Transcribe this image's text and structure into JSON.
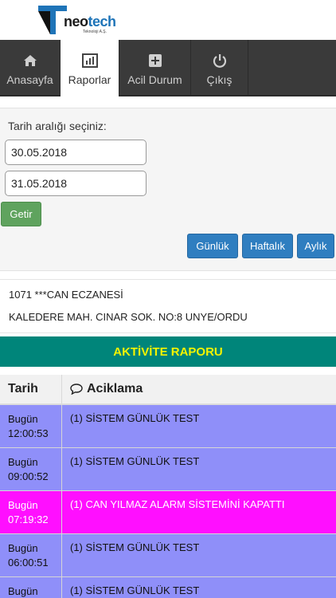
{
  "brand": {
    "name_part1": "neo",
    "name_part2": "tech",
    "subtitle": "Teknoloji A.Ş."
  },
  "nav": {
    "items": [
      {
        "label": "Anasayfa",
        "icon": "home-icon"
      },
      {
        "label": "Raporlar",
        "icon": "bar-chart-icon",
        "active": true
      },
      {
        "label": "Acil Durum",
        "icon": "plus-square-icon"
      },
      {
        "label": "Çıkış",
        "icon": "power-icon"
      }
    ]
  },
  "filter": {
    "label": "Tarih aralığı seçiniz:",
    "start_date": "30.05.2018",
    "end_date": "31.05.2018",
    "submit_label": "Getir",
    "range_buttons": [
      "Günlük",
      "Haftalık",
      "Aylık"
    ]
  },
  "customer": {
    "line1": "1071 ***CAN ECZANESİ",
    "line2": "KALEDERE MAH. CINAR SOK. NO:8 UNYE/ORDU"
  },
  "report": {
    "title": "AKTİVİTE RAPORU",
    "columns": [
      "Tarih",
      "Aciklama"
    ],
    "rows": [
      {
        "day": "Bugün",
        "time": "12:00:53",
        "desc": "(1) SİSTEM GÜNLÜK TEST",
        "color": "#8f8ff9"
      },
      {
        "day": "Bugün",
        "time": "09:00:52",
        "desc": "(1) SİSTEM GÜNLÜK TEST",
        "color": "#8f8ff9"
      },
      {
        "day": "Bugün",
        "time": "07:19:32",
        "desc": "(1) CAN YILMAZ ALARM SİSTEMİNİ KAPATTI",
        "color": "#ff0fff"
      },
      {
        "day": "Bugün",
        "time": "06:00:51",
        "desc": "(1) SİSTEM GÜNLÜK TEST",
        "color": "#8f8ff9"
      },
      {
        "day": "Bugün",
        "time": "",
        "desc": "(1) SİSTEM GÜNLÜK TEST",
        "color": "#8f8ff9"
      }
    ]
  },
  "colors": {
    "nav_bg": "#3a3a3a",
    "title_bg": "#00857a",
    "title_text": "#f3f300",
    "primary_button": "#2f7ec0",
    "success_button": "#5fa35e"
  }
}
